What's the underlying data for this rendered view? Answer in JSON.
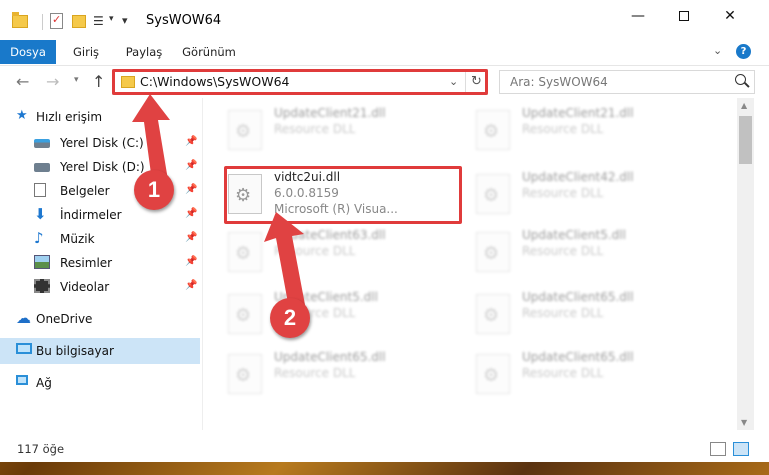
{
  "window": {
    "title": "SysWOW64",
    "minimize": "—",
    "close": "✕"
  },
  "ribbon": {
    "tabs": [
      "Dosya",
      "Giriş",
      "Paylaş",
      "Görünüm"
    ],
    "help": "?"
  },
  "nav": {
    "address": "C:\\Windows\\SysWOW64",
    "search_placeholder": "Ara: SysWOW64"
  },
  "sidebar": {
    "quick_access": "Hızlı erişim",
    "items": [
      "Yerel Disk (C:)",
      "Yerel Disk (D:)",
      "Belgeler",
      "İndirmeler",
      "Müzik",
      "Resimler",
      "Videolar"
    ],
    "onedrive": "OneDrive",
    "this_pc": "Bu bilgisayar",
    "network": "Ağ"
  },
  "files": {
    "highlighted": {
      "name": "vidtc2ui.dll",
      "version": "6.0.0.8159",
      "description": "Microsoft (R) Visua..."
    },
    "left": [
      {
        "name": "UpdateClient21.dll",
        "type": "Resource DLL"
      },
      {
        "name": "UpdateClient63.dll",
        "type": "Resource DLL"
      },
      {
        "name": "UpdateClient5.dll",
        "type": "Resource DLL"
      },
      {
        "name": "UpdateClient65.dll",
        "type": "Resource DLL"
      }
    ],
    "right": [
      {
        "name": "UpdateClient21.dll",
        "type": "Resource DLL"
      },
      {
        "name": "UpdateClient42.dll",
        "type": "Resource DLL"
      },
      {
        "name": "UpdateClient5.dll",
        "type": "Resource DLL"
      },
      {
        "name": "UpdateClient65.dll",
        "type": "Resource DLL"
      },
      {
        "name": "UpdateClient65.dll",
        "type": "Resource DLL"
      }
    ]
  },
  "status": {
    "count": "117 öğe"
  },
  "annotations": {
    "step1": "1",
    "step2": "2"
  },
  "colors": {
    "accent": "#1979ca",
    "annotation": "#e03b3b"
  }
}
